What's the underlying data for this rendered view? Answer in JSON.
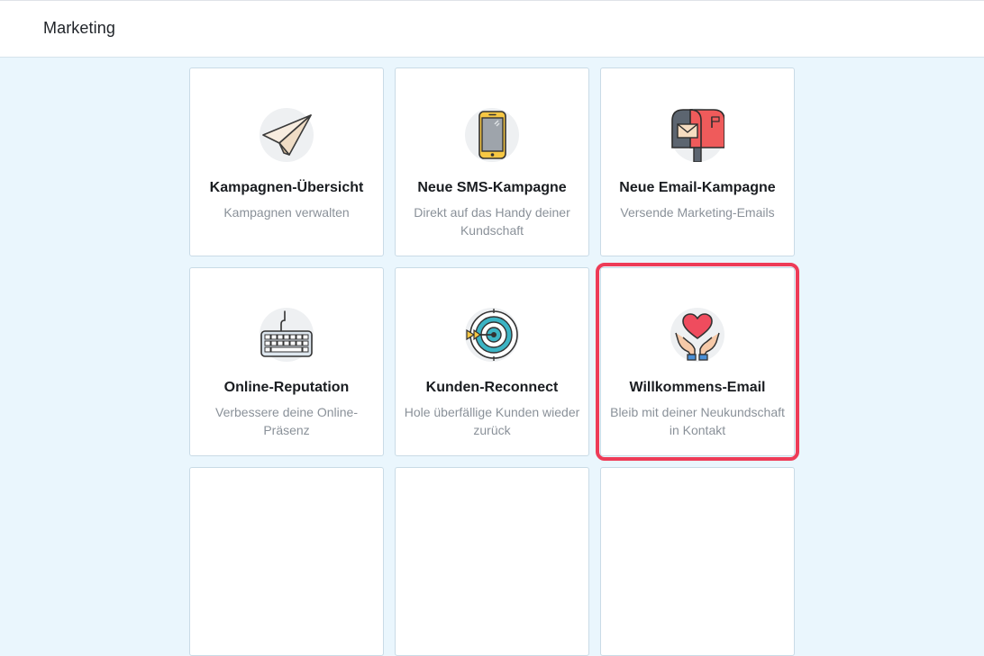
{
  "header": {
    "title": "Marketing"
  },
  "cards": [
    {
      "title": "Kampagnen-Übersicht",
      "description": "Kampagnen verwalten",
      "icon": "paper-plane-icon"
    },
    {
      "title": "Neue SMS-Kampagne",
      "description": "Direkt auf das Handy deiner Kundschaft",
      "icon": "smartphone-icon"
    },
    {
      "title": "Neue Email-Kampagne",
      "description": "Versende Marketing-Emails",
      "icon": "mailbox-icon"
    },
    {
      "title": "Online-Reputation",
      "description": "Verbessere deine Online-Präsenz",
      "icon": "keyboard-icon"
    },
    {
      "title": "Kunden-Reconnect",
      "description": "Hole überfällige Kunden wieder zurück",
      "icon": "target-icon"
    },
    {
      "title": "Willkommens-Email",
      "description": "Bleib mit deiner Neukundschaft in Kontakt",
      "icon": "heart-hands-icon"
    }
  ],
  "colors": {
    "highlight": "#ee3b57",
    "background": "#eaf6fd",
    "card_border": "#c9dbe6"
  }
}
